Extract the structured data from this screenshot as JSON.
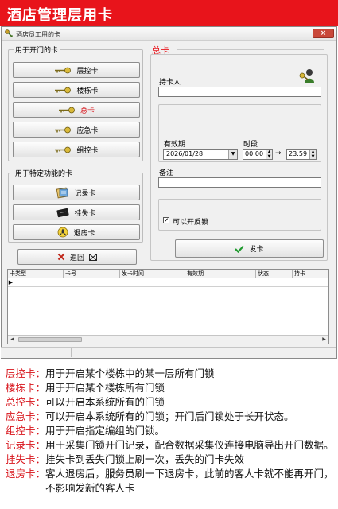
{
  "banner": {
    "title": "酒店管理层用卡"
  },
  "window": {
    "title": "酒店员工用的卡",
    "close_label": "×"
  },
  "door_group": {
    "legend": "用于开门的卡",
    "buttons": [
      {
        "label": "层控卡",
        "icon": "key-icon"
      },
      {
        "label": "楼栋卡",
        "icon": "key-icon"
      },
      {
        "label": "总卡",
        "icon": "key-icon"
      },
      {
        "label": "应急卡",
        "icon": "key-icon"
      },
      {
        "label": "组控卡",
        "icon": "key-icon"
      }
    ]
  },
  "special_group": {
    "legend": "用于特定功能的卡",
    "buttons": [
      {
        "label": "记录卡",
        "icon": "record-card-icon"
      },
      {
        "label": "挂失卡",
        "icon": "lost-card-icon"
      },
      {
        "label": "退房卡",
        "icon": "checkout-card-icon"
      }
    ]
  },
  "back_button": {
    "label": "返回",
    "icon": "close-x-icon"
  },
  "card_form": {
    "title": "总卡",
    "holder_label": "持卡人",
    "holder_value": "",
    "validity_label": "有效期",
    "date_value": "2026/01/28",
    "time_label": "时段",
    "time_start": "00:00",
    "time_arrow": "→",
    "time_end": "23:59",
    "remark_label": "备注",
    "remark_value": "",
    "deadbolt_label": "可以开反锁",
    "deadbolt_checked": true,
    "check_mark": "✔",
    "issue_button": "发卡"
  },
  "grid": {
    "columns": [
      "卡类型",
      "卡号",
      "发卡时间",
      "有效期",
      "状态",
      "持卡"
    ],
    "row_indicator": "▶"
  },
  "legend": [
    {
      "term": "层控卡：",
      "desc": "用于开启某个楼栋中的某一层所有门锁"
    },
    {
      "term": "楼栋卡：",
      "desc": "用于开启某个楼栋所有门锁"
    },
    {
      "term": "总控卡：",
      "desc": "可以开启本系统所有的门锁"
    },
    {
      "term": "应急卡：",
      "desc": "可以开启本系统所有的门锁；开门后门锁处于长开状态。"
    },
    {
      "term": "组控卡：",
      "desc": "用于开启指定编组的门锁。"
    },
    {
      "term": "记录卡：",
      "desc": "用于采集门锁开门记录，配合数据采集仪连接电脑导出开门数据。"
    },
    {
      "term": "挂失卡：",
      "desc": "挂失卡到丢失门锁上刷一次，丢失的门卡失效"
    },
    {
      "term": "退房卡：",
      "desc": "客人退房后，服务员刷一下退房卡，此前的客人卡就不能再开门，不影响发新的客人卡"
    }
  ],
  "colors": {
    "banner": "#e8141b",
    "accent_red": "#d8141b",
    "check_green": "#1f9a2e"
  }
}
